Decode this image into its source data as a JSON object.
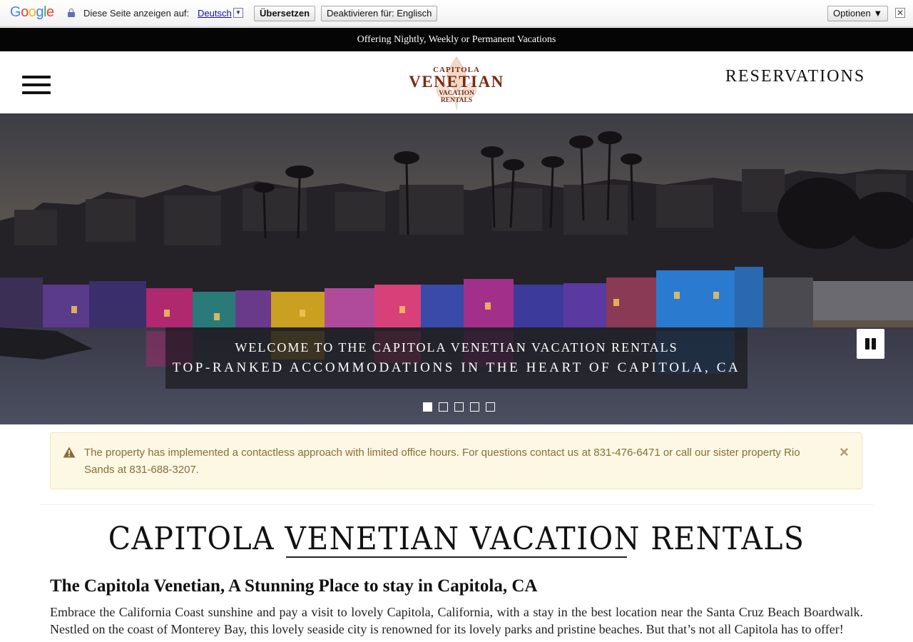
{
  "translate_bar": {
    "logo_letters": [
      "G",
      "o",
      "o",
      "g",
      "l",
      "e"
    ],
    "logo_colors": [
      "#4285f4",
      "#ea4335",
      "#fbbc05",
      "#4285f4",
      "#34a853",
      "#ea4335"
    ],
    "label": "Diese Seite anzeigen auf:",
    "language": "Deutsch",
    "translate_button": "Übersetzen",
    "disable_button": "Deaktivieren für: Englisch",
    "options_button": "Optionen ▼",
    "close_glyph": "✕"
  },
  "announcement": "Offering Nightly, Weekly or Permanent Vacations",
  "header": {
    "logo_top": "CAPITOLA",
    "logo_main": "VENETIAN",
    "logo_sub1": "VACATION",
    "logo_sub2": "RENTALS",
    "reservations": "RESERVATIONS"
  },
  "hero": {
    "caption_line1": "WELCOME TO THE CAPITOLA VENETIAN VACATION RENTALS",
    "caption_line2": "TOP-RANKED ACCOMMODATIONS IN THE HEART OF CAPITOLA, CA",
    "slide_count": 5,
    "active_slide": 1
  },
  "alert": {
    "text": "The property has implemented a contactless approach with limited office hours.  For questions contact us at 831-476-6471 or call our sister property  Rio Sands at 831-688-3207.",
    "close_glyph": "×"
  },
  "main": {
    "title": "CAPITOLA VENETIAN VACATION RENTALS",
    "section_heading": "The Capitola Venetian, A Stunning Place to stay in Capitola, CA",
    "paragraph": "Embrace the California Coast sunshine and pay a visit to lovely Capitola, California, with a stay in the best location near the Santa Cruz Beach Boardwalk. Nestled on the coast of Monterey Bay, this lovely seaside city is renowned for its lovely parks and pristine beaches. But that’s not all Capitola has to offer!"
  },
  "colors": {
    "brand": "#7a2a12",
    "alert_bg": "#fcf8e3",
    "alert_text": "#8a6d3b"
  }
}
